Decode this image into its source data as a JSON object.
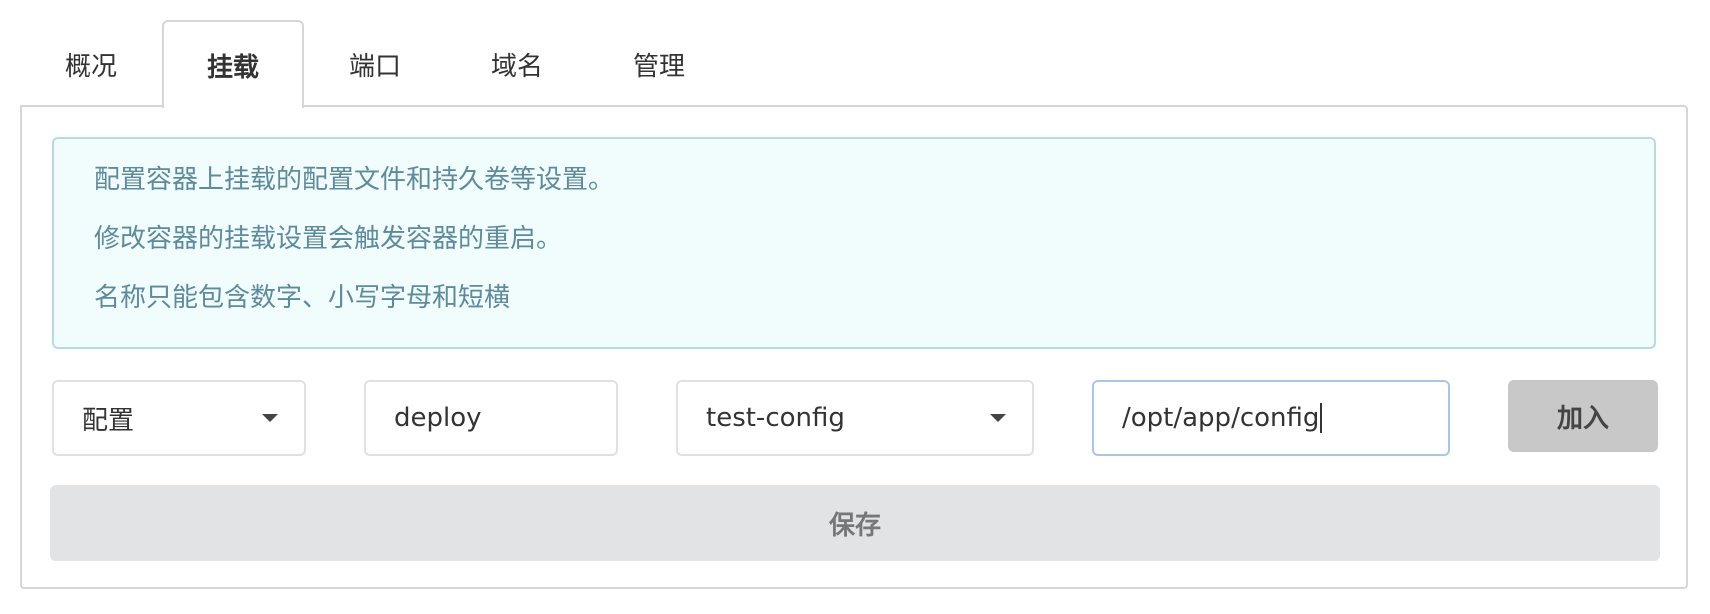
{
  "tabs": [
    {
      "label": "概况",
      "active": false
    },
    {
      "label": "挂载",
      "active": true
    },
    {
      "label": "端口",
      "active": false
    },
    {
      "label": "域名",
      "active": false
    },
    {
      "label": "管理",
      "active": false
    }
  ],
  "info": {
    "lines": [
      "配置容器上挂载的配置文件和持久卷等设置。",
      "修改容器的挂载设置会触发容器的重启。",
      "名称只能包含数字、小写字母和短横"
    ]
  },
  "mount_form": {
    "type_select": {
      "value": "配置"
    },
    "name_input": {
      "value": "deploy"
    },
    "config_select": {
      "value": "test-config"
    },
    "path_input": {
      "value": "/opt/app/config"
    },
    "add_button": {
      "label": "加入"
    }
  },
  "save_button": {
    "label": "保存"
  },
  "colors": {
    "info_bg": "#f1fcfd",
    "info_border": "#b4dce6",
    "info_text": "#5d8a9c",
    "add_button_bg": "#c8c8c8",
    "save_button_bg": "#e2e3e4"
  }
}
